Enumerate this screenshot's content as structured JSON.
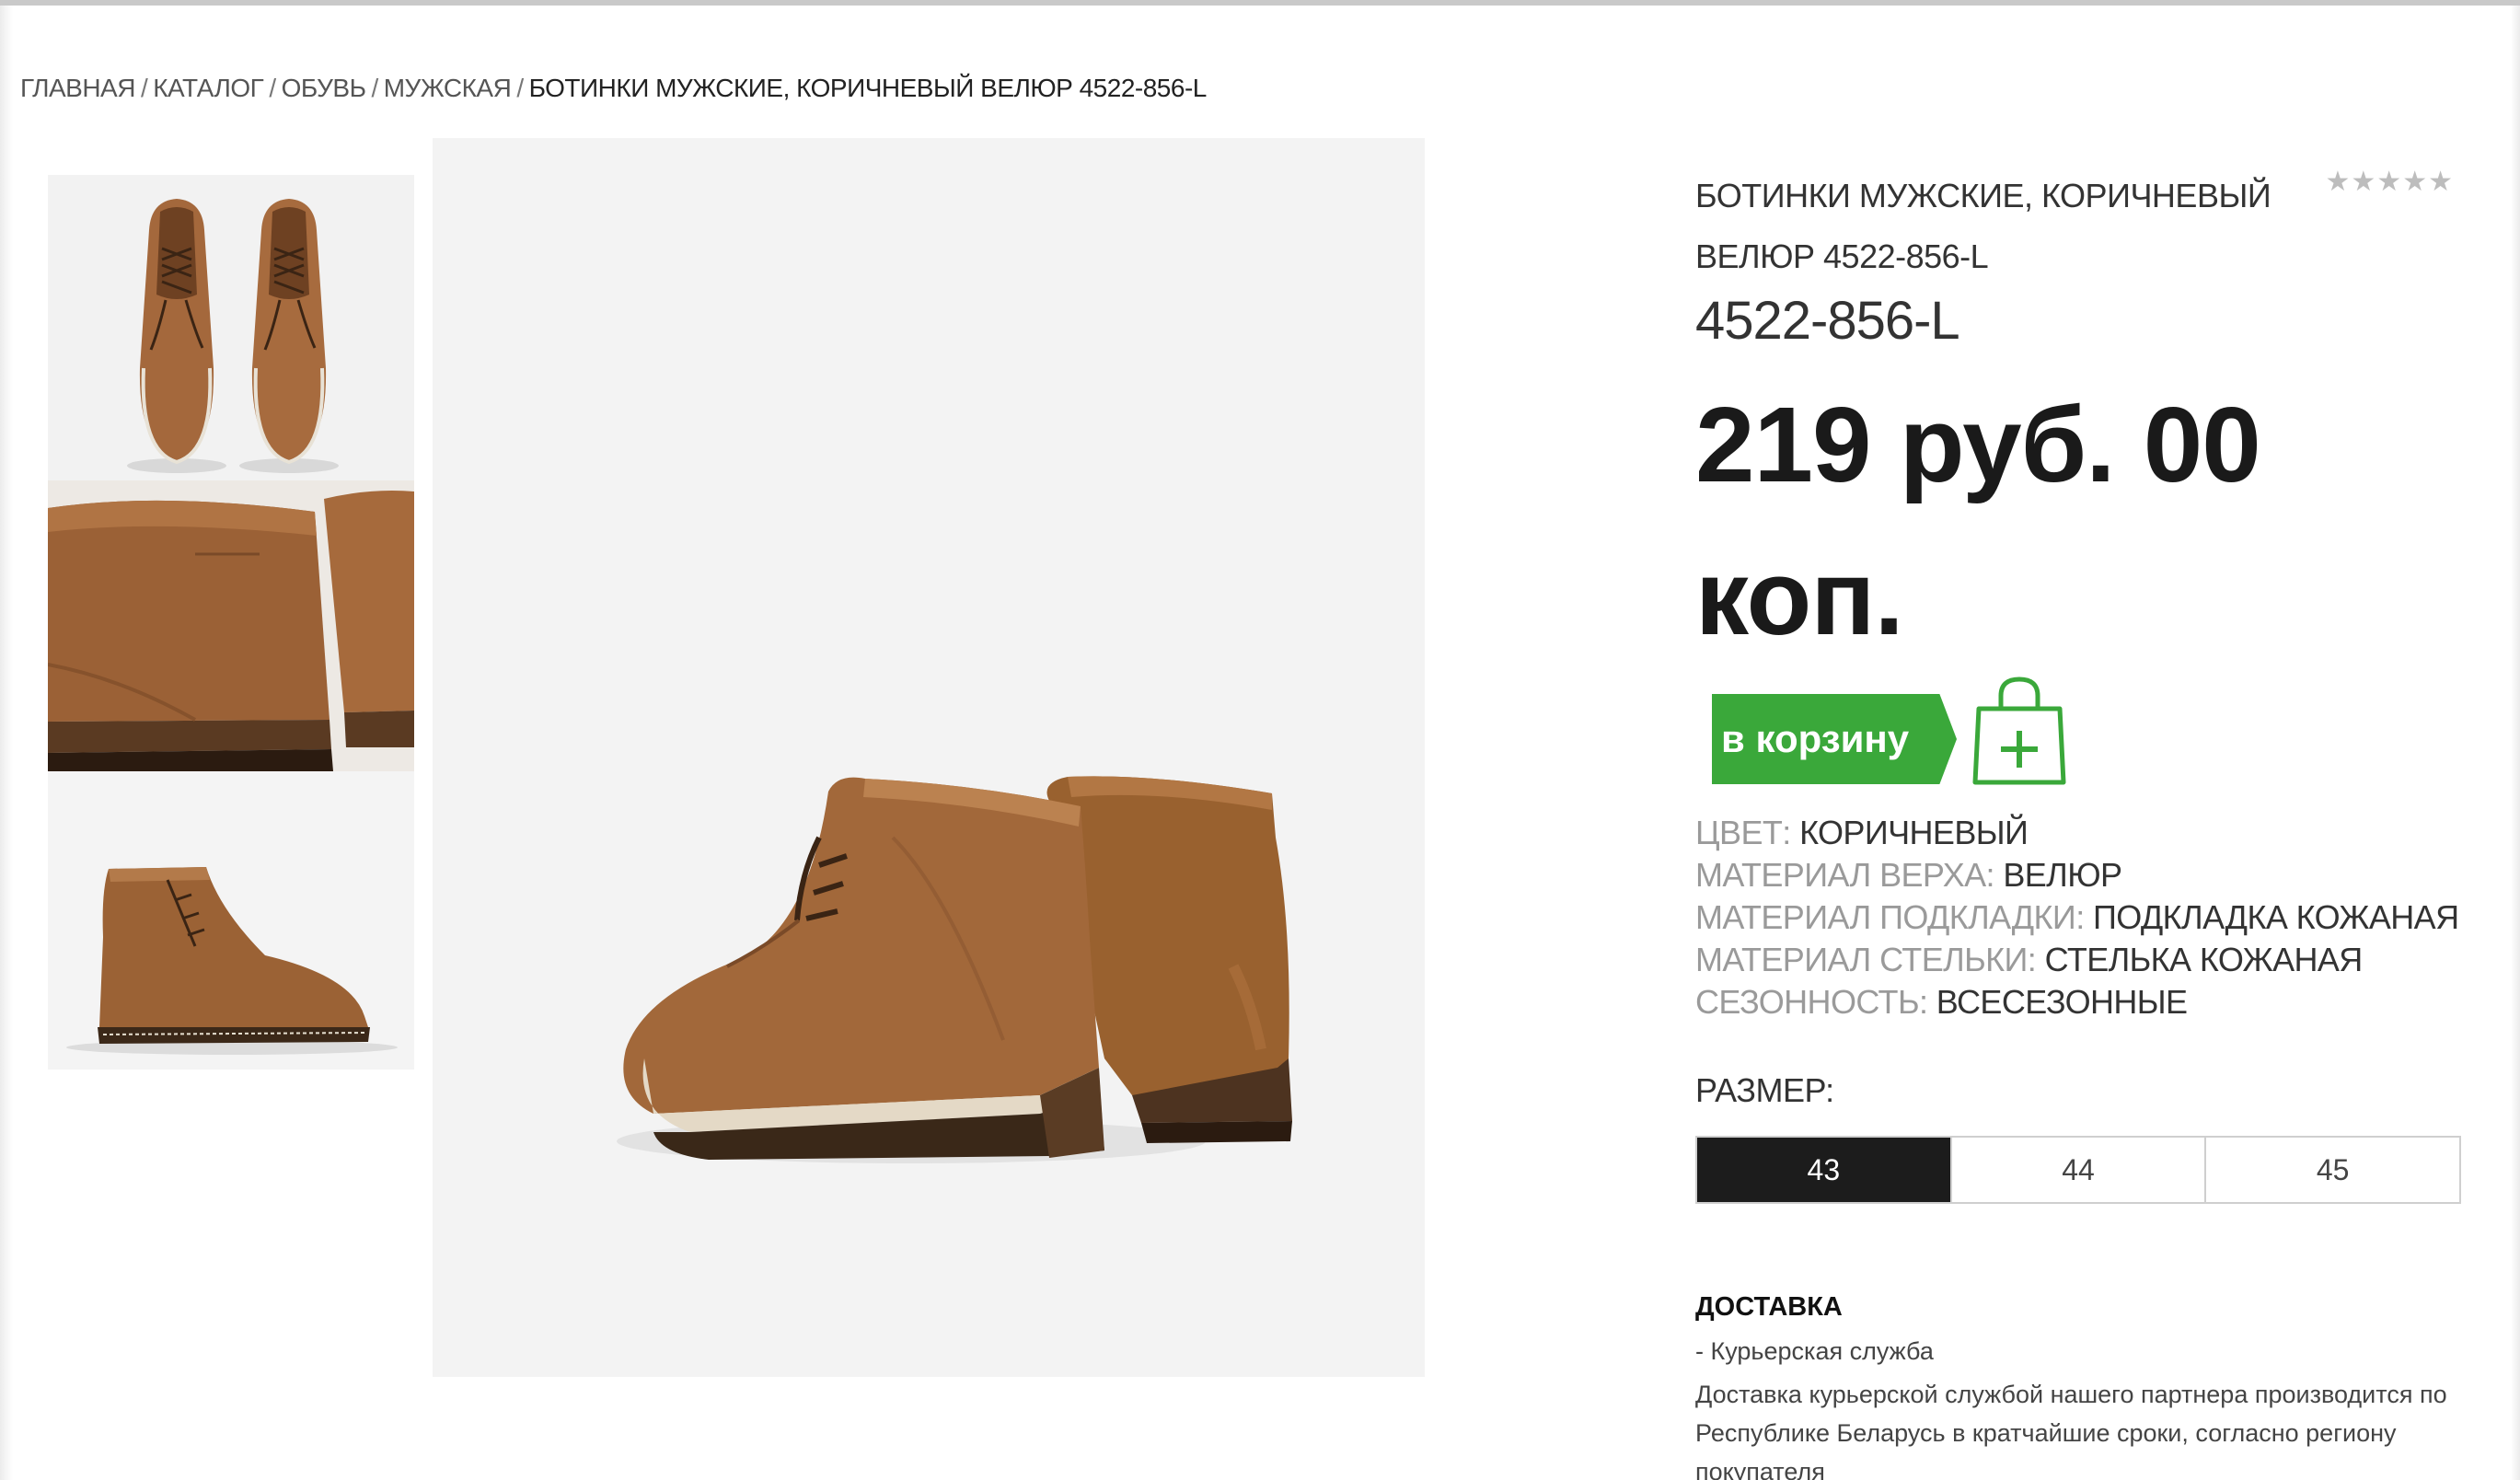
{
  "breadcrumb": {
    "items": [
      "ГЛАВНАЯ",
      "КАТАЛОГ",
      "ОБУВЬ",
      "МУЖСКАЯ"
    ],
    "separator": "/",
    "current": "БОТИНКИ МУЖСКИЕ, КОРИЧНЕВЫЙ ВЕЛЮР 4522-856-L"
  },
  "product": {
    "title": "БОТИНКИ МУЖСКИЕ, КОРИЧНЕВЫЙ ВЕЛЮР 4522-856-L",
    "rating_stars": "★★★★★",
    "rating_value": 0,
    "article": "4522-856-L",
    "price": "219 руб. 00 коп.",
    "add_to_cart": "в корзину",
    "cart_icon": "shopping-bag-plus-icon",
    "accent_color": "#3aa83a"
  },
  "specs": [
    {
      "label": "ЦВЕТ:",
      "value": "КОРИЧНЕВЫЙ"
    },
    {
      "label": "МАТЕРИАЛ ВЕРХА:",
      "value": "ВЕЛЮР"
    },
    {
      "label": "МАТЕРИАЛ ПОДКЛАДКИ:",
      "value": "ПОДКЛАДКА КОЖАНАЯ"
    },
    {
      "label": "МАТЕРИАЛ СТЕЛЬКИ:",
      "value": "СТЕЛЬКА КОЖАНАЯ"
    },
    {
      "label": "СЕЗОННОСТЬ:",
      "value": "ВСЕСЕЗОННЫЕ"
    }
  ],
  "sizes": {
    "label": "РАЗМЕР:",
    "options": [
      "43",
      "44",
      "45"
    ],
    "selected": "43"
  },
  "delivery": {
    "title": "ДОСТАВКА",
    "method": "- Курьерская служба",
    "text": "Доставка курьерской службой нашего партнера производится по Республике Беларусь в кратчайшие сроки, согласно региону покупателя"
  },
  "images": {
    "thumbnails": [
      "boots-top-view",
      "boots-heel-closeup",
      "boot-side-view"
    ],
    "main": "boots-rear-three-quarter-view"
  }
}
